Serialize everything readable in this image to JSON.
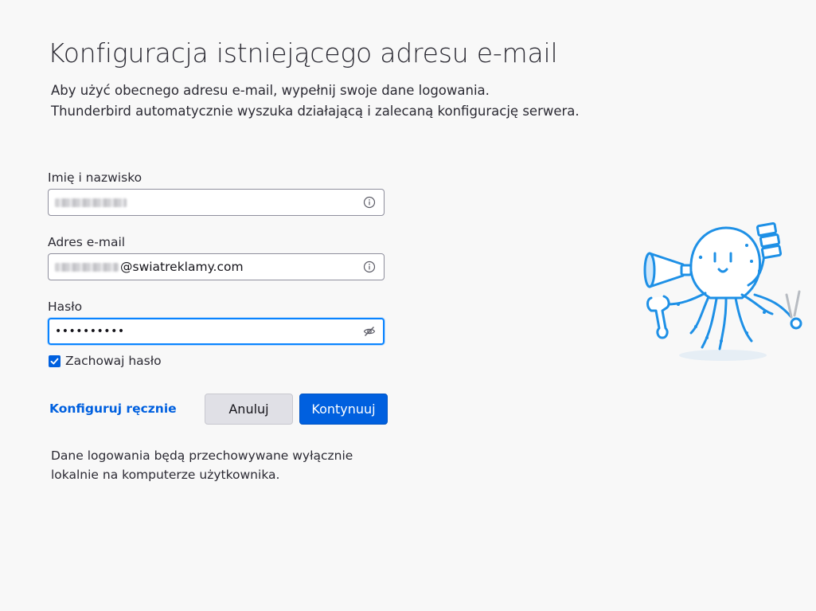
{
  "header": {
    "title": "Konfiguracja istniejącego adresu e-mail",
    "intro_line1": "Aby użyć obecnego adresu e-mail, wypełnij swoje dane logowania.",
    "intro_line2": "Thunderbird automatycznie wyszuka działającą i zalecaną konfigurację serwera."
  },
  "form": {
    "name_label": "Imię i nazwisko",
    "name_value": "",
    "name_icon": "info-icon",
    "email_label": "Adres e-mail",
    "email_domain": "@swiatreklamy.com",
    "email_icon": "info-icon",
    "password_label": "Hasło",
    "password_value": "••••••••••",
    "password_icon": "eye-slash-icon",
    "remember_label": "Zachowaj hasło",
    "remember_checked": true
  },
  "actions": {
    "manual_config": "Konfiguruj ręcznie",
    "cancel": "Anuluj",
    "continue": "Kontynuuj"
  },
  "footer": {
    "note_line1": "Dane logowania będą przechowywane wyłącznie",
    "note_line2": "lokalnie na komputerze użytkownika."
  },
  "colors": {
    "accent": "#0060df",
    "focus": "#0a84ff",
    "mascot": "#1e90e6"
  }
}
